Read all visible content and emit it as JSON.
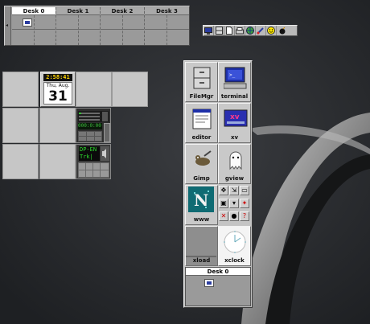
{
  "pager": {
    "desks": [
      {
        "label": "Desk 0",
        "active": true
      },
      {
        "label": "Desk 1",
        "active": false
      },
      {
        "label": "Desk 2",
        "active": false
      },
      {
        "label": "Desk 3",
        "active": false
      }
    ]
  },
  "clock_applet": {
    "time": "2:58:41",
    "weekday_month": "Thu, Aug.",
    "day": "31"
  },
  "cd_applet": {
    "display": "000:0:00"
  },
  "mixer_applet": {
    "line1": "DP-EN",
    "line2": "Trk|"
  },
  "panel": {
    "buttons": [
      {
        "label": "FileMgr",
        "icon": "file-cabinet-icon"
      },
      {
        "label": "terminal",
        "icon": "terminal-icon"
      },
      {
        "label": "editor",
        "icon": "editor-icon"
      },
      {
        "label": "xv",
        "icon": "xv-icon"
      },
      {
        "label": "Gimp",
        "icon": "gimp-icon"
      },
      {
        "label": "gview",
        "icon": "ghost-icon"
      },
      {
        "label": "www",
        "icon": "netscape-icon"
      },
      {
        "label": "xload",
        "icon": "xload-graph-icon"
      },
      {
        "label": "xclock",
        "icon": "analog-clock-icon"
      }
    ],
    "mini_pager_label": "Desk 0"
  },
  "colors": {
    "desktop": "#26282b",
    "panel": "#c4c4c4",
    "clock_time": "#ffd400",
    "lcd_green": "#2edc2e"
  }
}
